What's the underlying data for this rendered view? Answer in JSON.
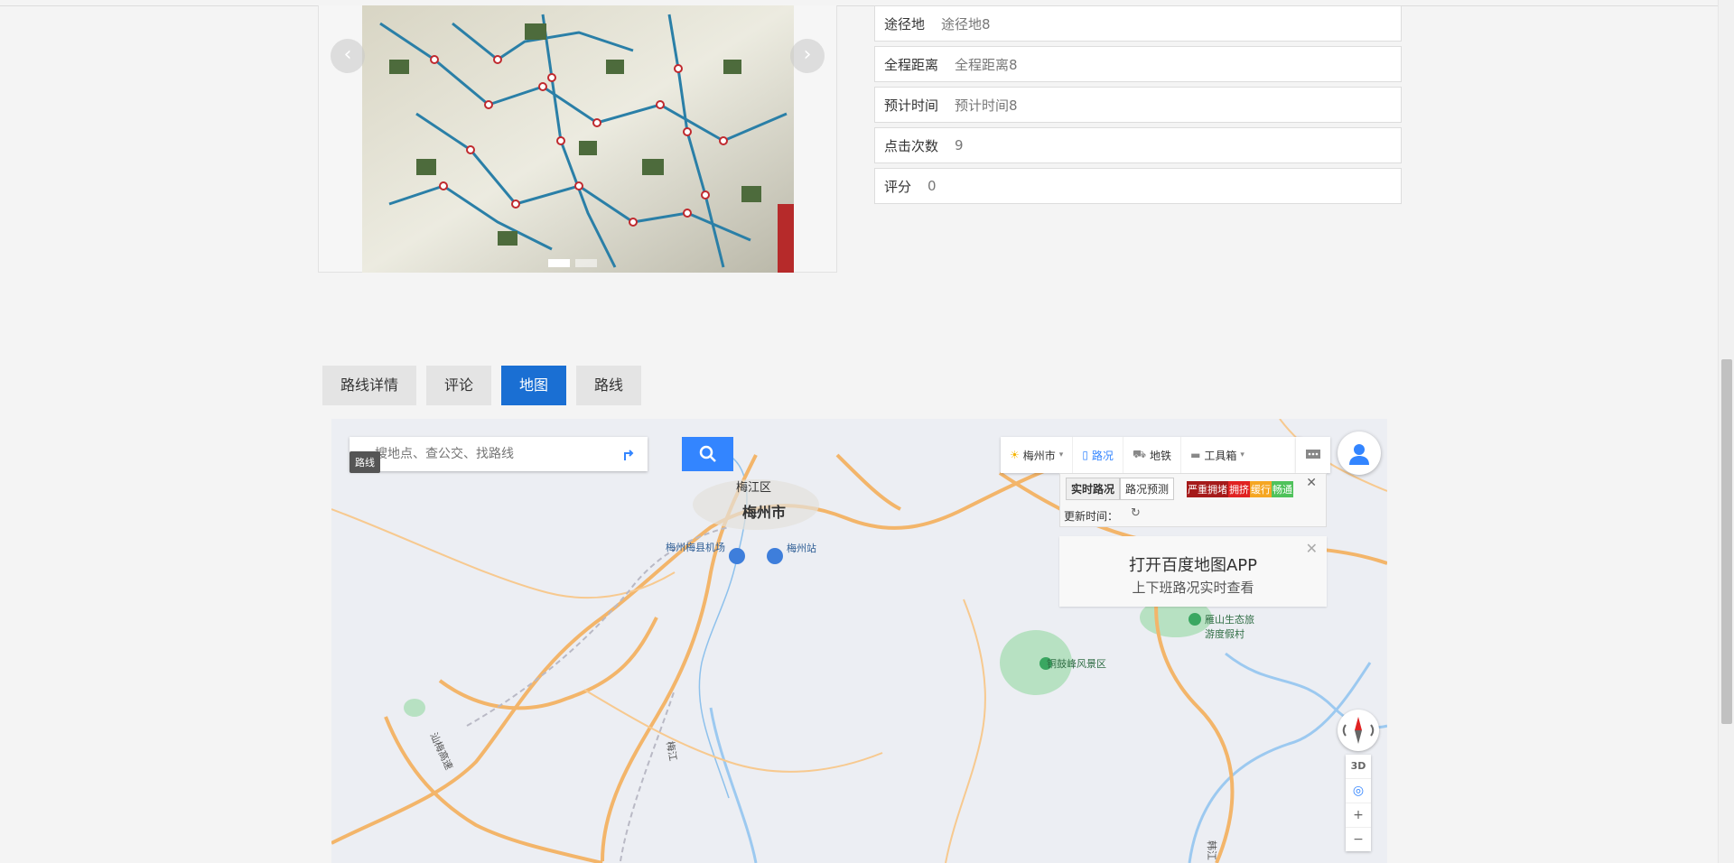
{
  "carousel": {
    "prev_label": "‹",
    "next_label": "›",
    "slide_count": 2,
    "active_slide": 1
  },
  "info_rows": [
    {
      "label": "途径地",
      "value": "途径地8"
    },
    {
      "label": "全程距离",
      "value": "全程距离8"
    },
    {
      "label": "预计时间",
      "value": "预计时间8"
    },
    {
      "label": "点击次数",
      "value": "9"
    },
    {
      "label": "评分",
      "value": "0"
    }
  ],
  "tabs": [
    {
      "label": "路线详情",
      "active": false
    },
    {
      "label": "评论",
      "active": false
    },
    {
      "label": "地图",
      "active": true
    },
    {
      "label": "路线",
      "active": false
    }
  ],
  "map": {
    "search": {
      "placeholder": "搜地点、查公交、找路线"
    },
    "tooltip": "路线",
    "toolbar": {
      "city": "梅州市",
      "traffic": "路况",
      "subway": "地铁",
      "tools": "工具箱"
    },
    "traffic_panel": {
      "tab_realtime": "实时路况",
      "tab_forecast": "路况预测",
      "legend": [
        "严重拥堵",
        "拥挤",
        "缓行",
        "畅通"
      ],
      "legend_colors": [
        "#a51a1a",
        "#e02222",
        "#f5a623",
        "#4fc25b"
      ],
      "update_label": "更新时间："
    },
    "promo": {
      "title": "打开百度地图APP",
      "subtitle": "上下班路况实时查看"
    },
    "labels": {
      "meijiang": "梅江区",
      "meizhou": "梅州市",
      "airport": "梅州梅县机场",
      "station": "梅州站",
      "tonggu": "铜鼓峰风景区",
      "yanshan": "雁山生态旅游度假村",
      "shanzhan": "汕梅高速",
      "meijiang_river": "梅江",
      "hanjiang": "韩江"
    },
    "controls": {
      "three_d": "3D",
      "zoom_in": "+",
      "zoom_out": "−"
    }
  }
}
